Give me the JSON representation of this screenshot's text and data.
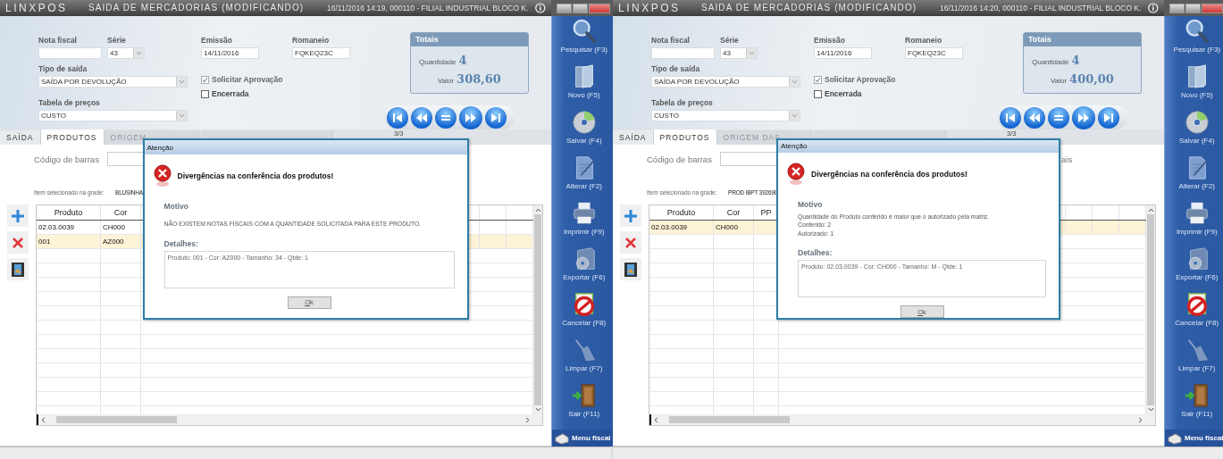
{
  "screens": [
    {
      "logo": "LINXPOS",
      "title": "SAIDA DE MERCADORIAS (MODIFICANDO)",
      "session": "16/11/2016 14:19, 000110 - FILIAL INDUSTRIAL BLOCO K.",
      "form": {
        "nota_fiscal": {
          "label": "Nota fiscal"
        },
        "serie": {
          "label": "Série",
          "value": "43"
        },
        "emissao": {
          "label": "Emissão",
          "value": "14/11/2016"
        },
        "romaneio": {
          "label": "Romaneio",
          "value": "FQKEQ23C"
        },
        "tipo_saida": {
          "label": "Tipo de saída",
          "value": "SAÍDA POR DEVOLUÇÃO"
        },
        "tabela_precos": {
          "label": "Tabela de preços",
          "value": "CUSTO"
        },
        "checkboxes": [
          {
            "label": "Solicitar Aprovação",
            "checked": true,
            "disabled": true
          },
          {
            "label": "Encerrada",
            "checked": false,
            "disabled": false
          }
        ]
      },
      "totais": {
        "title": "Totais",
        "quantidade_label": "Quantidade",
        "quantidade": "4",
        "valor_label": "Valor",
        "valor": "308,60"
      },
      "record_counter": "3/3",
      "tabs": [
        {
          "label": "SAÍDA",
          "selected": false,
          "disabled": false
        },
        {
          "label": "PRODUTOS",
          "selected": true,
          "disabled": false
        },
        {
          "label": "ORIGEM",
          "selected": false,
          "disabled": true
        },
        {
          "selected": false,
          "disabled": true
        }
      ],
      "barcode": {
        "label": "Código de barras"
      },
      "grid_item": {
        "label": "Item selecionado na grade:",
        "value": "BLUSINHA"
      },
      "table": {
        "columns": [
          "Produto",
          "Cor"
        ],
        "rows": [
          {
            "cells": [
              "02.03.0039",
              "CH000"
            ],
            "selected": false
          },
          {
            "cells": [
              "001",
              "AZ000"
            ],
            "selected": true
          }
        ]
      },
      "dialog": {
        "title": "Atenção",
        "heading": "Divergências na conferência dos produtos!",
        "motivo_label": "Motivo",
        "motivo_lines": [
          "NÃO EXISTEM NOTAS FISCAIS COM A QUANTIDADE SOLICITADA PARA ESTE PRODUTO."
        ],
        "detalhes_label": "Detalhes:",
        "detalhes": "Produto: 001 - Cor: AZ000 - Tamanho: 34 - Qtde: 1",
        "ok": "Ok"
      },
      "sidebar": {
        "items": [
          {
            "label": "Pesquisar (F3)",
            "kind": "search"
          },
          {
            "label": "Novo (F5)",
            "kind": "new"
          },
          {
            "label": "Salvar (F4)",
            "kind": "save"
          },
          {
            "label": "Alterar (F2)",
            "kind": "edit"
          },
          {
            "label": "Imprimir (F9)",
            "kind": "print"
          },
          {
            "label": "Exportar (F6)",
            "kind": "export"
          },
          {
            "label": "Cancelar (F8)",
            "kind": "cancel"
          },
          {
            "label": "Limpar (F7)",
            "kind": "clear"
          },
          {
            "label": "Sair (F11)",
            "kind": "exit"
          }
        ],
        "menu": "Menu fiscal"
      }
    },
    {
      "logo": "LINXPOS",
      "title": "SAIDA DE MERCADORIAS (MODIFICANDO)",
      "session": "16/11/2016 14:20, 000110 - FILIAL INDUSTRIAL BLOCO K.",
      "form": {
        "nota_fiscal": {
          "label": "Nota fiscal"
        },
        "serie": {
          "label": "Série",
          "value": "43"
        },
        "emissao": {
          "label": "Emissão",
          "value": "14/11/2016"
        },
        "romaneio": {
          "label": "Romaneio",
          "value": "FQKEQ23C"
        },
        "tipo_saida": {
          "label": "Tipo de saída",
          "value": "SAÍDA POR DEVOLUÇÃO"
        },
        "tabela_precos": {
          "label": "Tabela de preços",
          "value": "CUSTO"
        },
        "checkboxes": [
          {
            "label": "Solicitar Aprovação",
            "checked": true,
            "disabled": true
          },
          {
            "label": "Encerrada",
            "checked": false,
            "disabled": false
          }
        ]
      },
      "totais": {
        "title": "Totais",
        "quantidade_label": "Quantidade",
        "quantidade": "4",
        "valor_label": "Valor",
        "valor": "400,00"
      },
      "record_counter": "3/3",
      "tabs": [
        {
          "label": "SAÍDA",
          "selected": false,
          "disabled": false
        },
        {
          "label": "PRODUTOS",
          "selected": true,
          "disabled": false
        },
        {
          "label": "ORIGEM DAS",
          "selected": false,
          "disabled": true
        },
        {
          "selected": false,
          "disabled": true
        }
      ],
      "barcode": {
        "label": "Código de barras"
      },
      "side_label": "ais",
      "grid_item": {
        "label": "Item selecionado na grade:",
        "value": "PROD IBPT 392690"
      },
      "table": {
        "columns": [
          "Produto",
          "Cor",
          "PP"
        ],
        "rows": [
          {
            "cells": [
              "02.03.0039",
              "CH000"
            ],
            "selected": true
          }
        ]
      },
      "dialog": {
        "title": "Atenção",
        "heading": "Divergências na conferência dos produtos!",
        "motivo_label": "Motivo",
        "motivo_lines": [
          "Quantidade do Produto conferido é maior que o autorizado pela matriz.",
          "Conferido: 2",
          "Autorizado: 1"
        ],
        "detalhes_label": "Detalhes:",
        "detalhes": "Produto: 02.03.0039 - Cor: CH000 - Tamanho: M - Qtde: 1",
        "ok": "Ok"
      },
      "sidebar": {
        "items": [
          {
            "label": "Pesquisar (F3)",
            "kind": "search"
          },
          {
            "label": "Novo (F5)",
            "kind": "new"
          },
          {
            "label": "Salvar (F4)",
            "kind": "save"
          },
          {
            "label": "Alterar (F2)",
            "kind": "edit"
          },
          {
            "label": "Imprimir (F9)",
            "kind": "print"
          },
          {
            "label": "Exportar (F6)",
            "kind": "export"
          },
          {
            "label": "Cancelar (F8)",
            "kind": "cancel"
          },
          {
            "label": "Limpar (F7)",
            "kind": "clear"
          },
          {
            "label": "Sair (F11)",
            "kind": "exit"
          }
        ],
        "menu": "Menu fiscal"
      }
    }
  ]
}
